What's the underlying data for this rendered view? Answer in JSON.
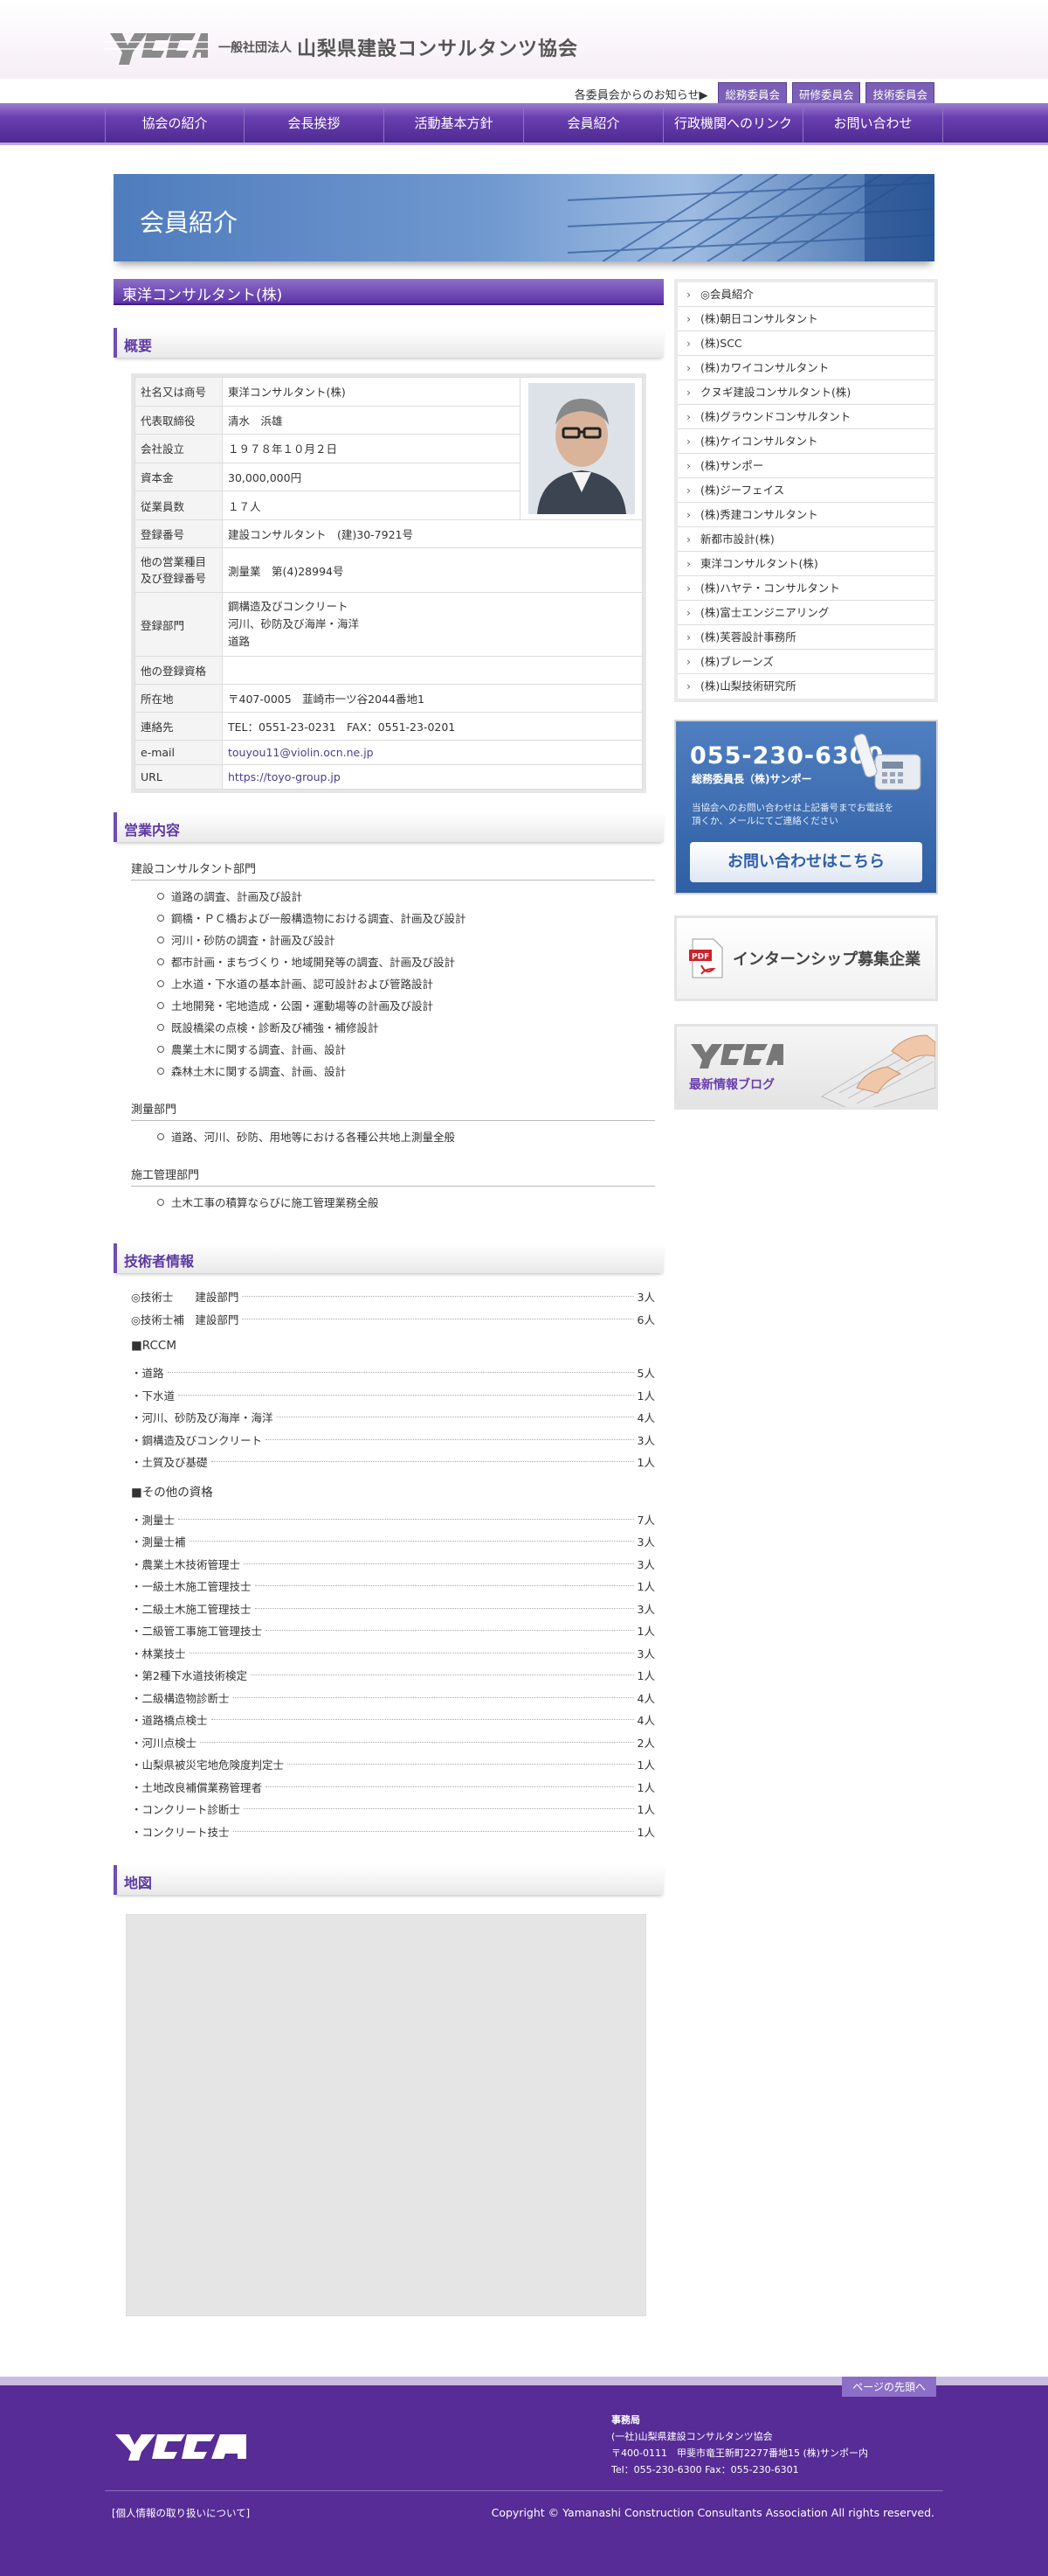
{
  "header": {
    "org_prefix": "一般社団法人",
    "org_name": "山梨県建設コンサルタンツ協会",
    "logo_text": "YCCA",
    "notice_label": "各委員会からのお知らせ▶",
    "committees": [
      "総務委員会",
      "研修委員会",
      "技術委員会"
    ]
  },
  "nav": [
    "協会の紹介",
    "会長挨拶",
    "活動基本方針",
    "会員紹介",
    "行政機関へのリンク",
    "お問い合わせ"
  ],
  "banner": {
    "title": "会員紹介"
  },
  "company": {
    "title": "東洋コンサルタント(株)",
    "overview_heading": "概要",
    "profile": [
      {
        "k": "社名又は商号",
        "v": "東洋コンサルタント(株)"
      },
      {
        "k": "代表取締役",
        "v": "清水　浜雄"
      },
      {
        "k": "会社設立",
        "v": "１９７８年１０月２日"
      },
      {
        "k": "資本金",
        "v": "30,000,000円"
      },
      {
        "k": "従業員数",
        "v": "１７人"
      },
      {
        "k": "登録番号",
        "v": "建設コンサルタント　(建)30-7921号"
      },
      {
        "k": "他の営業種目\n及び登録番号",
        "v": "測量業　第(4)28994号"
      },
      {
        "k": "登録部門",
        "v": "鋼構造及びコンクリート\n河川、砂防及び海岸・海洋\n道路"
      },
      {
        "k": "他の登録資格",
        "v": ""
      },
      {
        "k": "所在地",
        "v": "〒407-0005　韮崎市一ツ谷2044番地1"
      },
      {
        "k": "連絡先",
        "v": "TEL：0551-23-0231　FAX：0551-23-0201"
      },
      {
        "k": "e-mail",
        "v": "touyou11@violin.ocn.ne.jp"
      },
      {
        "k": "URL",
        "v": "https://toyo-group.jp"
      }
    ]
  },
  "business": {
    "heading": "営業内容",
    "categories": [
      {
        "name": "建設コンサルタント部門",
        "items": [
          "道路の調査、計画及び設計",
          "鋼橋・ＰＣ橋および一般構造物における調査、計画及び設計",
          "河川・砂防の調査・計画及び設計",
          "都市計画・まちづくり・地域開発等の調査、計画及び設計",
          "上水道・下水道の基本計画、認可設計および管路設計",
          "土地開発・宅地造成・公園・運動場等の計画及び設計",
          "既設橋梁の点検・診断及び補強・補修設計",
          "農業土木に関する調査、計画、設計",
          "森林土木に関する調査、計画、設計"
        ]
      },
      {
        "name": "測量部門",
        "items": [
          "道路、河川、砂防、用地等における各種公共地上測量全般"
        ]
      },
      {
        "name": "施工管理部門",
        "items": [
          "土木工事の積算ならびに施工管理業務全般"
        ]
      }
    ]
  },
  "engineers": {
    "heading": "技術者情報",
    "top": [
      {
        "n": "◎技術士　　建設部門",
        "c": "3人"
      },
      {
        "n": "◎技術士補　建設部門",
        "c": "6人"
      }
    ],
    "rccm_heading": "■RCCM",
    "rccm": [
      {
        "n": "・道路",
        "c": "5人"
      },
      {
        "n": "・下水道",
        "c": "1人"
      },
      {
        "n": "・河川、砂防及び海岸・海洋",
        "c": "4人"
      },
      {
        "n": "・鋼構造及びコンクリート",
        "c": "3人"
      },
      {
        "n": "・土質及び基礎",
        "c": "1人"
      }
    ],
    "other_heading": "■その他の資格",
    "other": [
      {
        "n": "・測量士",
        "c": "7人"
      },
      {
        "n": "・測量士補",
        "c": "3人"
      },
      {
        "n": "・農業土木技術管理士",
        "c": "3人"
      },
      {
        "n": "・一級土木施工管理技士",
        "c": "1人"
      },
      {
        "n": "・二級土木施工管理技士",
        "c": "3人"
      },
      {
        "n": "・二級管工事施工管理技士",
        "c": "1人"
      },
      {
        "n": "・林業技士",
        "c": "3人"
      },
      {
        "n": "・第2種下水道技術検定",
        "c": "1人"
      },
      {
        "n": "・二級構造物診断士",
        "c": "4人"
      },
      {
        "n": "・道路橋点検士",
        "c": "4人"
      },
      {
        "n": "・河川点検士",
        "c": "2人"
      },
      {
        "n": "・山梨県被災宅地危険度判定士",
        "c": "1人"
      },
      {
        "n": "・土地改良補償業務管理者",
        "c": "1人"
      },
      {
        "n": "・コンクリート診断士",
        "c": "1人"
      },
      {
        "n": "・コンクリート技士",
        "c": "1人"
      }
    ]
  },
  "map": {
    "heading": "地図"
  },
  "sidebar": {
    "members": [
      "◎会員紹介",
      "(株)朝日コンサルタント",
      "(株)SCC",
      "(株)カワイコンサルタント",
      "クヌギ建設コンサルタント(株)",
      "(株)グラウンドコンサルタント",
      "(株)ケイコンサルタント",
      "(株)サンポー",
      "(株)ジーフェイス",
      "(株)秀建コンサルタント",
      "新都市設計(株)",
      "東洋コンサルタント(株)",
      "(株)ハヤテ・コンサルタント",
      "(株)富士エンジニアリング",
      "(株)芙蓉設計事務所",
      "(株)ブレーンズ",
      "(株)山梨技術研究所"
    ],
    "contact": {
      "tel": "055-230-6300",
      "role": "総務委員長（株)サンポー",
      "note": "当協会へのお問い合わせは上記番号までお電話を\n頂くか、メールにてご連絡ください",
      "button": "お問い合わせはこちら"
    },
    "intern": "インターンシップ募集企業",
    "blog": "最新情報ブログ"
  },
  "footer": {
    "pagetop": "ページの先頭へ",
    "office_head": "事務局",
    "office_lines": [
      "(一社)山梨県建設コンサルタンツ協会",
      "〒400-0111　甲斐市竜王新町2277番地15 (株)サンポー内",
      "Tel：055-230-6300 Fax：055-230-6301"
    ],
    "privacy": "[個人情報の取り扱いについて]",
    "copyright": "Copyright © Yamanashi Construction Consultants Association All rights reserved."
  }
}
